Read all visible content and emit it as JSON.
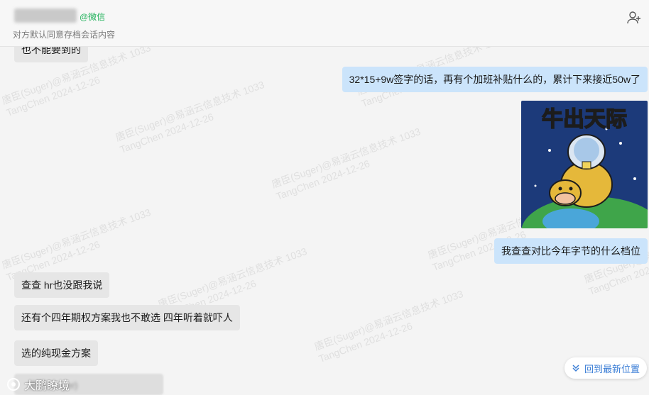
{
  "header": {
    "source": "@微信",
    "subtitle": "对方默认同意存档会话内容"
  },
  "watermark": {
    "line1": "唐臣(Suger)@易涵云信息技术 1033",
    "line2": "TangChen 2024-12-26"
  },
  "messages": [
    {
      "from": "me",
      "text": "32*15+9w签字的话，再有个加班补贴什么的，累计下来接近50w了"
    },
    {
      "from": "me",
      "type": "sticker",
      "text": "牛出天际"
    },
    {
      "from": "me",
      "text": "我查查对比今年字节的什么档位"
    },
    {
      "from": "them",
      "text": "查查 hr也没跟我说"
    },
    {
      "from": "them",
      "text": "还有个四年期权方案我也不敢选 四年听着就吓人"
    },
    {
      "from": "them",
      "text": "选的纯现金方案"
    }
  ],
  "partial_top_text": "也不能要到的",
  "blurred_sender": "唐臣(Suger)",
  "scroll_latest_label": "回到最新位置",
  "brand_label": "大鹏瞭境",
  "icons": {
    "add_member": "add-member-icon",
    "scroll": "double-chevron-down-icon"
  },
  "colors": {
    "out_bubble": "#cbe4fb",
    "in_bubble": "#e6e6e6",
    "accent": "#3b7ed6",
    "wechat": "#20b15a"
  }
}
